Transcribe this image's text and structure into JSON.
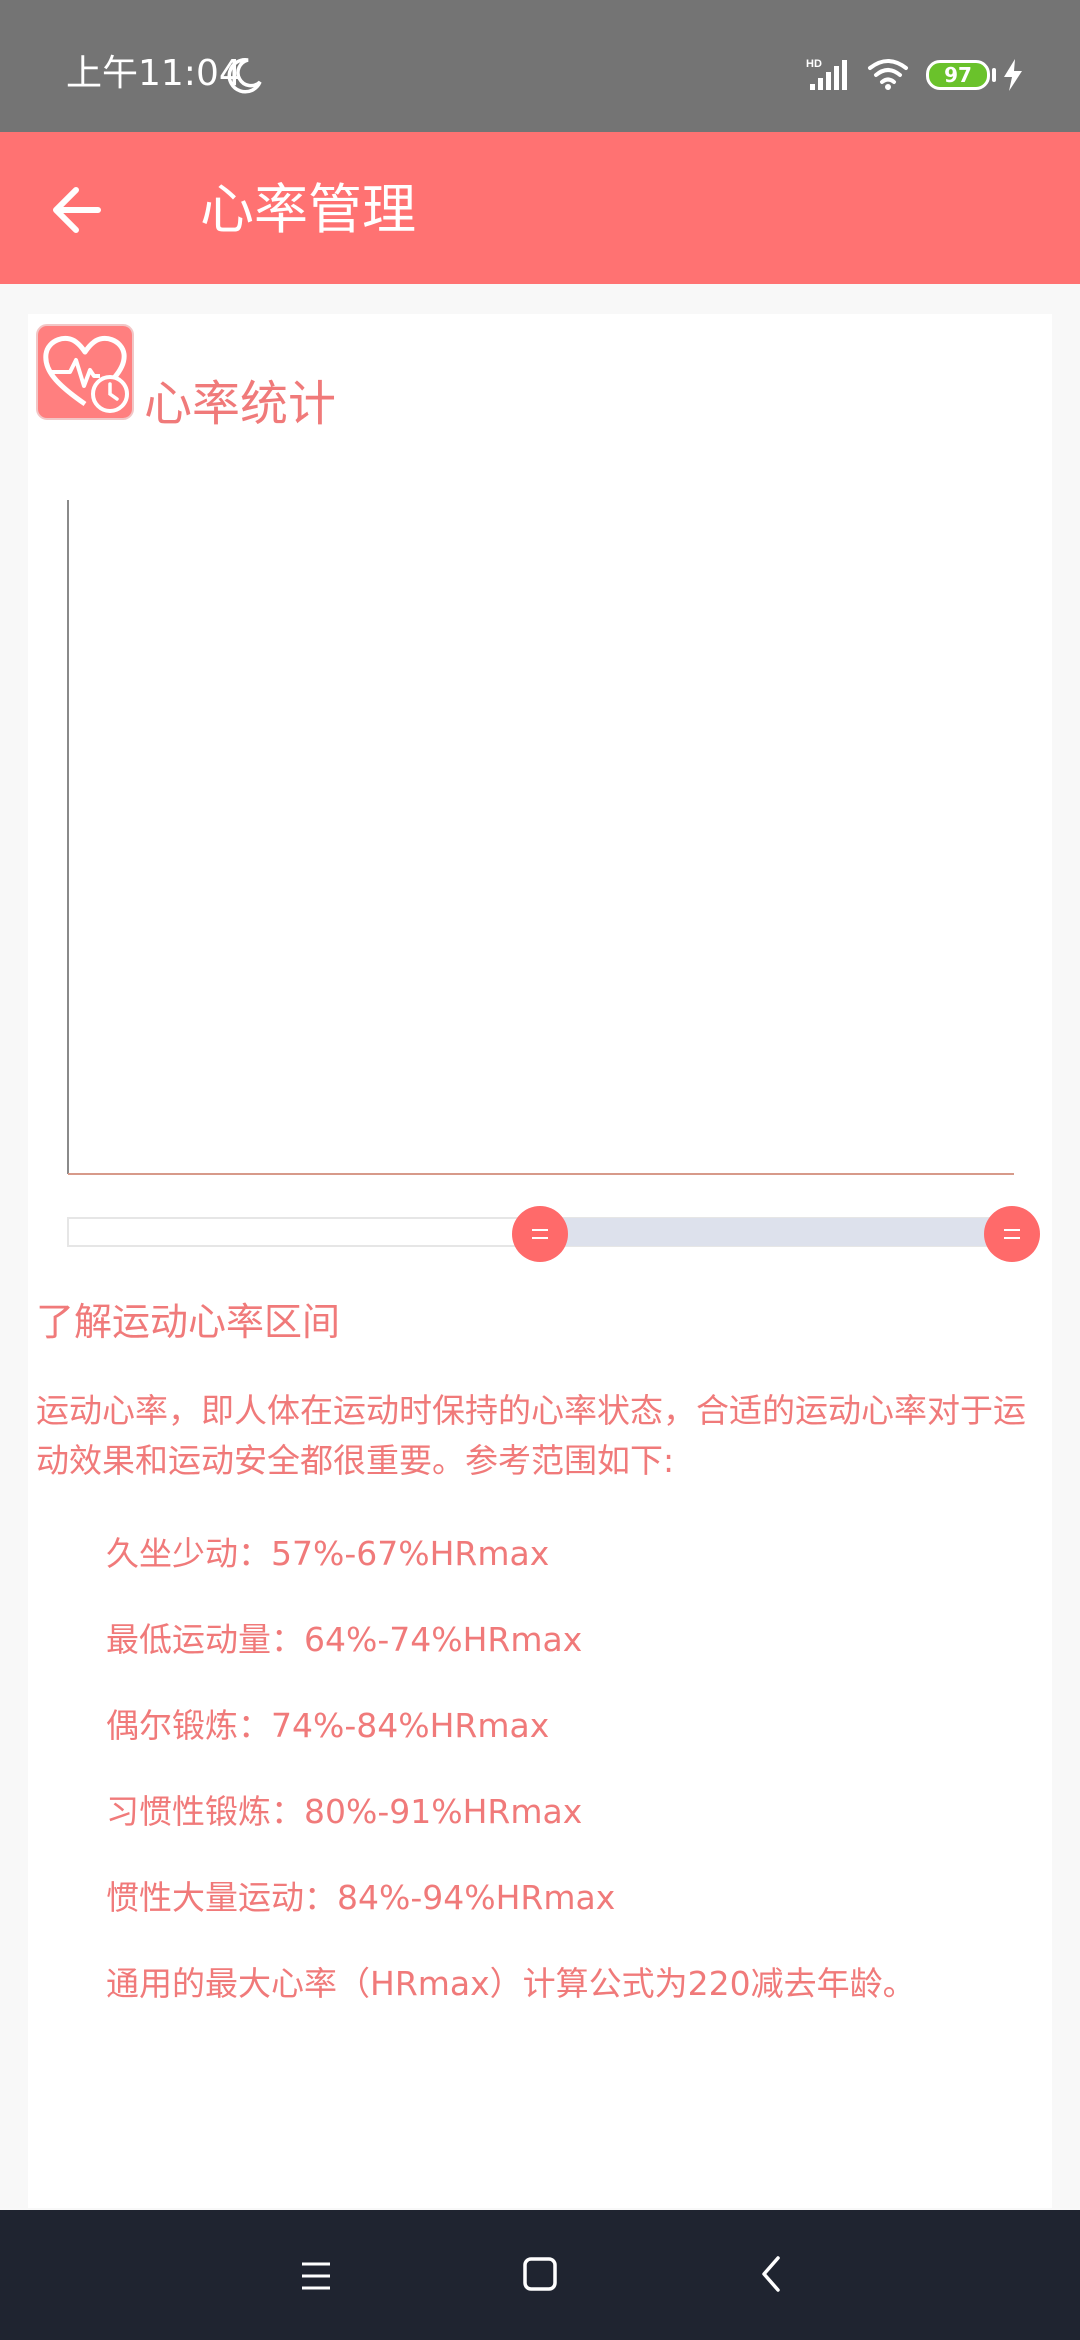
{
  "status": {
    "time": "上午11:04",
    "network": "HD",
    "battery": "97",
    "icons": [
      "moon-icon",
      "signal-icon",
      "wifi-icon",
      "battery-icon",
      "charging-icon"
    ]
  },
  "appbar": {
    "title": "心率管理",
    "back_icon": "arrow-left-icon",
    "background": "#ff7272"
  },
  "card": {
    "title": "心率统计",
    "logo_icon": "heart-rate-icon"
  },
  "chart_data": {
    "type": "line",
    "title": "",
    "series": [],
    "grid": false,
    "range_slider": {
      "start": 0.5,
      "end": 1.0
    }
  },
  "info": {
    "heading": "了解运动心率区间",
    "intro": "运动心率，即人体在运动时保持的心率状态，合适的运动心率对于运动效果和运动安全都很重要。参考范围如下:",
    "zones": [
      "久坐少动：57%-67%HRmax",
      "最低运动量：64%-74%HRmax",
      "偶尔锻炼：74%-84%HRmax",
      "习惯性锻炼：80%-91%HRmax",
      "惯性大量运动：84%-94%HRmax",
      "通用的最大心率（HRmax）计算公式为220减去年龄。"
    ],
    "text_color": "#f07a7a"
  },
  "navbar": {
    "icons": [
      "menu-icon",
      "home-icon",
      "back-icon"
    ]
  }
}
